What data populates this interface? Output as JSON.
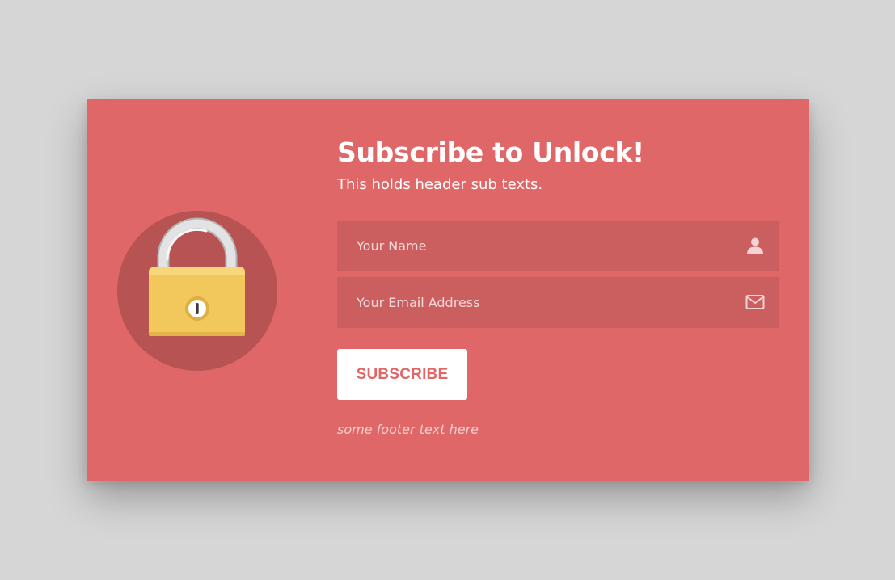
{
  "popup": {
    "title": "Subscribe to Unlock!",
    "subtitle": "This holds header sub texts.",
    "name_field": {
      "placeholder": "Your Name",
      "value": "",
      "icon": "user-icon"
    },
    "email_field": {
      "placeholder": "Your Email Address",
      "value": "",
      "icon": "envelope-icon"
    },
    "subscribe_label": "SUBSCRIBE",
    "footer_text": "some footer text here",
    "lock_icon": "padlock-icon"
  },
  "colors": {
    "page_background": "#d6d6d6",
    "card_background": "#e06767",
    "lock_circle": "#b85353",
    "input_background": "#cb5e5e",
    "button_background": "#ffffff",
    "button_text": "#e06767",
    "padlock_body": "#f2c75c",
    "padlock_shackle": "#d9d9d9"
  }
}
